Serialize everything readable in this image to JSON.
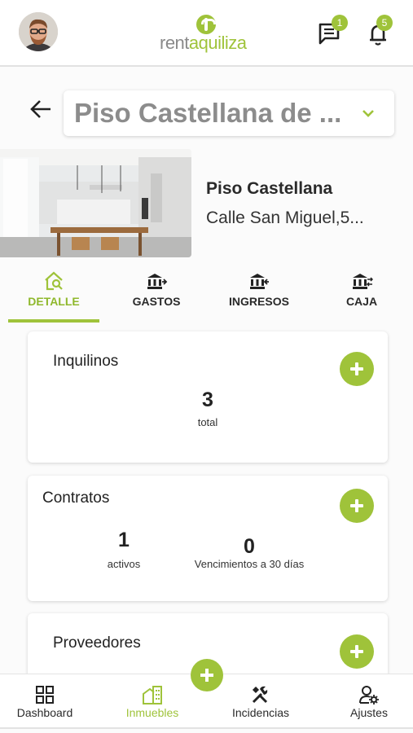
{
  "header": {
    "logo_part1": "rent",
    "logo_part2": "aquiliza",
    "messages_count": "1",
    "notifications_count": "5"
  },
  "property": {
    "selector_text": "Piso Castellana de ...",
    "name": "Piso Castellana",
    "address": "Calle San Miguel,5..."
  },
  "tabs": [
    {
      "label": "DETALLE",
      "icon": "house-search-icon",
      "active": true
    },
    {
      "label": "GASTOS",
      "icon": "bank-out-icon"
    },
    {
      "label": "INGRESOS",
      "icon": "bank-in-icon"
    },
    {
      "label": "CAJA",
      "icon": "bank-exchange-icon"
    }
  ],
  "cards": {
    "inquilinos": {
      "title": "Inquilinos",
      "count": "3",
      "count_label": "total"
    },
    "contratos": {
      "title": "Contratos",
      "activos": "1",
      "activos_label": "activos",
      "vencimientos": "0",
      "vencimientos_label": "Vencimientos a 30 días"
    },
    "proveedores": {
      "title": "Proveedores"
    }
  },
  "bottom_nav": [
    {
      "label": "Dashboard",
      "icon": "dashboard-icon"
    },
    {
      "label": "Inmuebles",
      "icon": "building-icon",
      "active": true
    },
    {
      "label": "Incidencias",
      "icon": "tools-icon"
    },
    {
      "label": "Ajustes",
      "icon": "user-gear-icon"
    }
  ],
  "colors": {
    "accent": "#9fc33a",
    "text": "#222222",
    "muted": "#8c8c8c"
  }
}
